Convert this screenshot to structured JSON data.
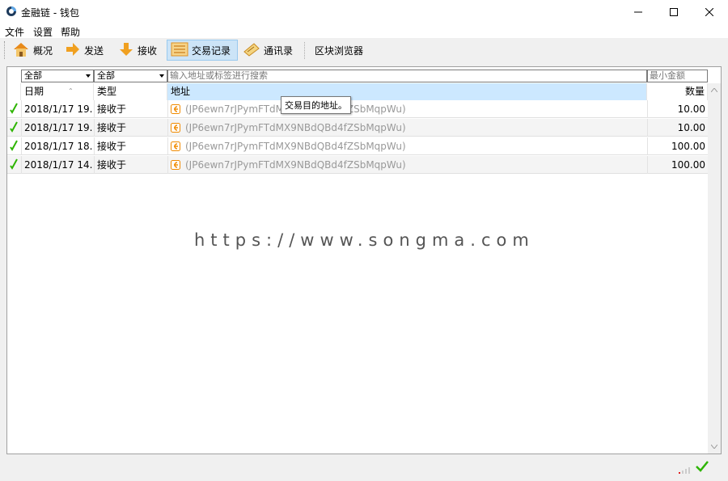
{
  "window": {
    "title": "金融链 - 钱包",
    "minimize_icon": "minimize-icon",
    "maximize_icon": "maximize-icon",
    "close_icon": "close-icon"
  },
  "menu": {
    "items": [
      "文件",
      "设置",
      "帮助"
    ]
  },
  "toolbar": {
    "overview": {
      "label": "概况",
      "icon": "home-icon"
    },
    "send": {
      "label": "发送",
      "icon": "send-arrow-icon"
    },
    "receive": {
      "label": "接收",
      "icon": "receive-arrow-icon"
    },
    "transactions": {
      "label": "交易记录",
      "icon": "list-icon",
      "active": true
    },
    "addressbook": {
      "label": "通讯录",
      "icon": "addressbook-icon"
    },
    "blockexplorer": {
      "label": "区块浏览器"
    }
  },
  "filters": {
    "date_filter": "全部",
    "type_filter": "全部",
    "search_placeholder": "输入地址或标签进行搜索",
    "min_amount_placeholder": "最小金额"
  },
  "table": {
    "headers": {
      "date": "日期",
      "type": "类型",
      "address": "地址",
      "amount": "数量"
    },
    "rows": [
      {
        "date": "2018/1/17 19...",
        "type": "接收于",
        "address": "(JP6ewn7rJPymFTdMX9NBdQBd4fZSbMqpWu)",
        "amount": "10.00"
      },
      {
        "date": "2018/1/17 19...",
        "type": "接收于",
        "address": "(JP6ewn7rJPymFTdMX9NBdQBd4fZSbMqpWu)",
        "amount": "10.00"
      },
      {
        "date": "2018/1/17 18...",
        "type": "接收于",
        "address": "(JP6ewn7rJPymFTdMX9NBdQBd4fZSbMqpWu)",
        "amount": "100.00"
      },
      {
        "date": "2018/1/17 14...",
        "type": "接收于",
        "address": "(JP6ewn7rJPymFTdMX9NBdQBd4fZSbMqpWu)",
        "amount": "100.00"
      }
    ]
  },
  "tooltip": {
    "text": "交易目的地址。"
  },
  "watermark": {
    "text": "https://www.songma.com"
  },
  "colors": {
    "accent": "#cce4f7",
    "check_green": "#2db400",
    "receive_orange": "#f08a00"
  }
}
